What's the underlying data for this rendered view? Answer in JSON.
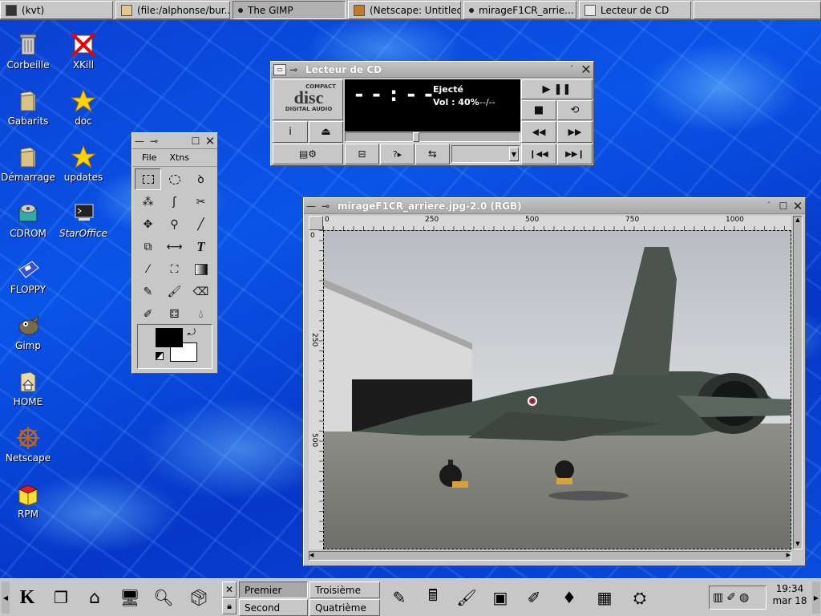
{
  "taskbar": {
    "tasks": [
      {
        "label": "(kvt)"
      },
      {
        "label": "(file:/alphonse/bur..."
      },
      {
        "label": "The GIMP"
      },
      {
        "label": "(Netscape: Untitled)"
      },
      {
        "label": "mirageF1CR_arrie..."
      },
      {
        "label": "Lecteur de CD"
      }
    ]
  },
  "desktop": {
    "icons": [
      {
        "label": "Corbeille"
      },
      {
        "label": "XKill"
      },
      {
        "label": "Gabarits"
      },
      {
        "label": "doc"
      },
      {
        "label": "Démarrage"
      },
      {
        "label": "updates"
      },
      {
        "label": "CDROM"
      },
      {
        "label": "StarOffice"
      },
      {
        "label": "FLOPPY"
      },
      {
        "label": "Gimp"
      },
      {
        "label": "HOME"
      },
      {
        "label": "Netscape"
      },
      {
        "label": "RPM"
      }
    ]
  },
  "cd_player": {
    "title": "Lecteur de CD",
    "logo_top": "COMPACT",
    "logo_mid": "disc",
    "logo_bottom": "DIGITAL AUDIO",
    "time": "--:--",
    "status": "Ejecté",
    "volume": "Vol : 40%",
    "track_time": "--/--",
    "info_label": "i",
    "eject_label": "⏏",
    "play_pause": "▶ ❚❚",
    "stop": "■",
    "loop": "⟲",
    "rewind": "◀◀",
    "forward": "▶▶",
    "prev": "❙◀◀",
    "next": "▶▶❙",
    "help_label": "?▸"
  },
  "gimp_toolbox": {
    "menu": [
      "File",
      "Xtns"
    ]
  },
  "image_window": {
    "title": "mirageF1CR_arriere.jpg-2.0 (RGB)",
    "hruler": [
      "0",
      "250",
      "500",
      "750",
      "1000"
    ],
    "vruler": [
      "0",
      "250",
      "500"
    ]
  },
  "panel": {
    "pagers": [
      {
        "label": "Premier"
      },
      {
        "label": "Troisième"
      },
      {
        "label": "Second"
      },
      {
        "label": "Quatrième"
      }
    ],
    "clock_time": "19:34",
    "clock_date": "mar 18"
  }
}
